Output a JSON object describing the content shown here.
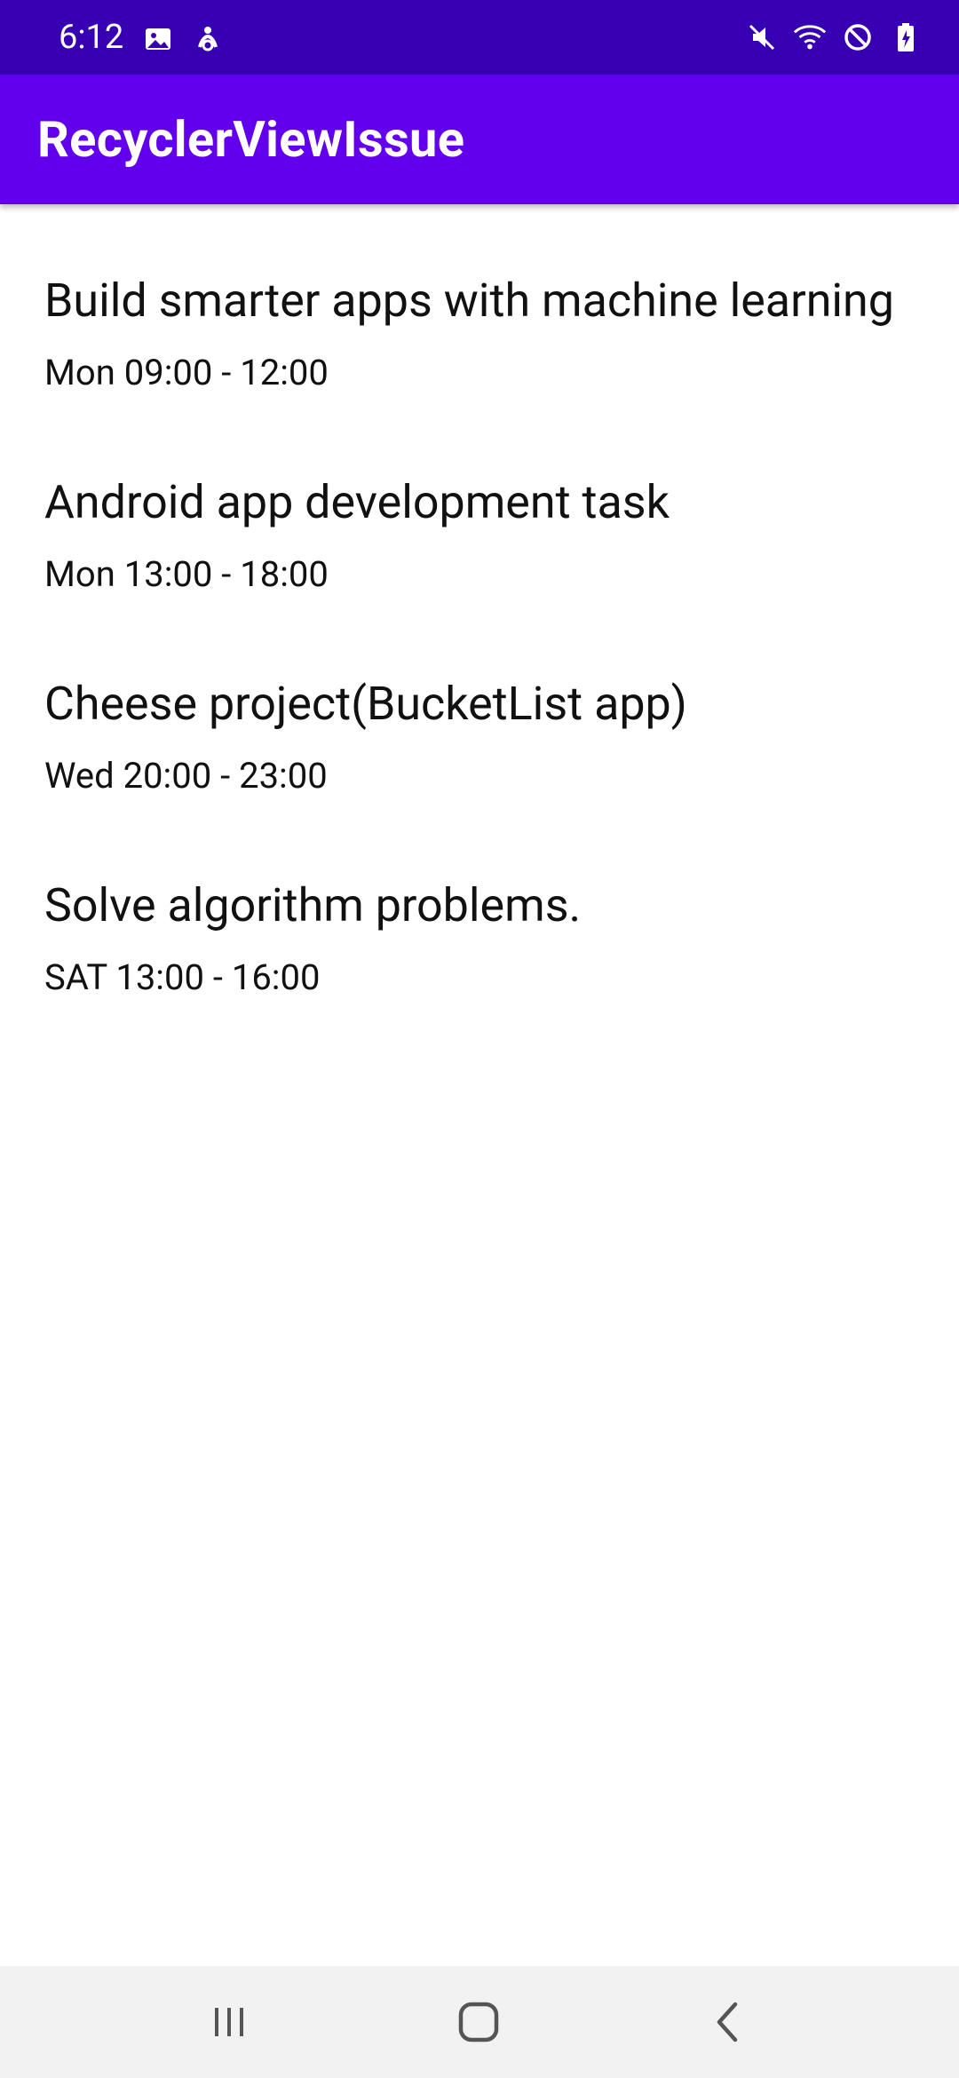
{
  "status_bar": {
    "time": "6:12",
    "left_icons": [
      "gallery-icon",
      "accessibility-icon"
    ],
    "right_icons": [
      "mute-icon",
      "wifi-icon",
      "do-not-disturb-icon",
      "battery-icon"
    ]
  },
  "app_bar": {
    "title": "RecyclerViewIssue"
  },
  "items": [
    {
      "title": "Build smarter apps with machine learning",
      "time": "Mon  09:00 - 12:00"
    },
    {
      "title": "Android app development task",
      "time": "Mon  13:00 - 18:00"
    },
    {
      "title": "Cheese project(BucketList app)",
      "time": "Wed  20:00 - 23:00"
    },
    {
      "title": "Solve algorithm problems.",
      "time": "SAT  13:00 - 16:00"
    }
  ],
  "nav_bar": {
    "buttons": [
      "recents-icon",
      "home-icon",
      "back-icon"
    ]
  },
  "colors": {
    "status_bar": "#3700b3",
    "app_bar": "#6200ee",
    "nav_bar": "#f2f2f2"
  }
}
